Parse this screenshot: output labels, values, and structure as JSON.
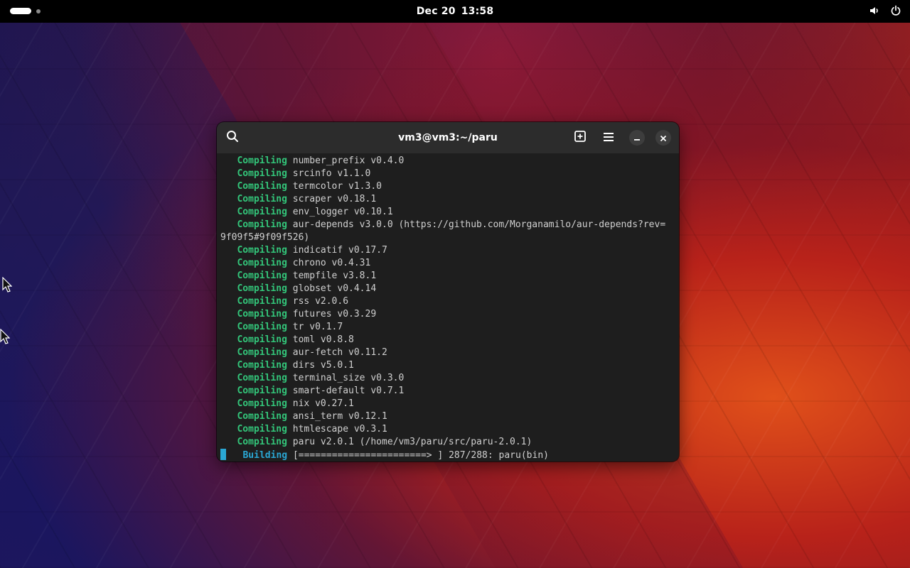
{
  "topbar": {
    "date": "Dec 20",
    "time": "13:58"
  },
  "window": {
    "title": "vm3@vm3:~/paru"
  },
  "terminal": {
    "compile_keyword": "Compiling",
    "lines": [
      {
        "kw": "Compiling",
        "text": " number_prefix v0.4.0"
      },
      {
        "kw": "Compiling",
        "text": " srcinfo v1.1.0"
      },
      {
        "kw": "Compiling",
        "text": " termcolor v1.3.0"
      },
      {
        "kw": "Compiling",
        "text": " scraper v0.18.1"
      },
      {
        "kw": "Compiling",
        "text": " env_logger v0.10.1"
      },
      {
        "kw": "Compiling",
        "text": " aur-depends v3.0.0 (https://github.com/Morganamilo/aur-depends?rev="
      },
      {
        "kw": "",
        "text": "9f09f5#9f09f526)"
      },
      {
        "kw": "Compiling",
        "text": " indicatif v0.17.7"
      },
      {
        "kw": "Compiling",
        "text": " chrono v0.4.31"
      },
      {
        "kw": "Compiling",
        "text": " tempfile v3.8.1"
      },
      {
        "kw": "Compiling",
        "text": " globset v0.4.14"
      },
      {
        "kw": "Compiling",
        "text": " rss v2.0.6"
      },
      {
        "kw": "Compiling",
        "text": " futures v0.3.29"
      },
      {
        "kw": "Compiling",
        "text": " tr v0.1.7"
      },
      {
        "kw": "Compiling",
        "text": " toml v0.8.8"
      },
      {
        "kw": "Compiling",
        "text": " aur-fetch v0.11.2"
      },
      {
        "kw": "Compiling",
        "text": " dirs v5.0.1"
      },
      {
        "kw": "Compiling",
        "text": " terminal_size v0.3.0"
      },
      {
        "kw": "Compiling",
        "text": " smart-default v0.7.1"
      },
      {
        "kw": "Compiling",
        "text": " nix v0.27.1"
      },
      {
        "kw": "Compiling",
        "text": " ansi_term v0.12.1"
      },
      {
        "kw": "Compiling",
        "text": " htmlescape v0.3.1"
      },
      {
        "kw": "Compiling",
        "text": " paru v2.0.1 (/home/vm3/paru/src/paru-2.0.1)"
      }
    ],
    "progress": {
      "keyword": "Building",
      "bar": "[=======================> ]",
      "status": "287/288: paru(bin)",
      "done": 287,
      "total": 288
    }
  },
  "colors": {
    "compiling": "#33c67a",
    "building": "#2aa7d4",
    "terminal_bg": "#1e1e1e",
    "titlebar_bg": "#2c2c2c"
  },
  "icons": {
    "search": "search-icon",
    "new_tab": "new-tab-icon",
    "menu": "hamburger-menu-icon",
    "minimize": "minimize-icon",
    "close": "close-icon",
    "volume": "volume-icon",
    "power": "power-icon"
  }
}
